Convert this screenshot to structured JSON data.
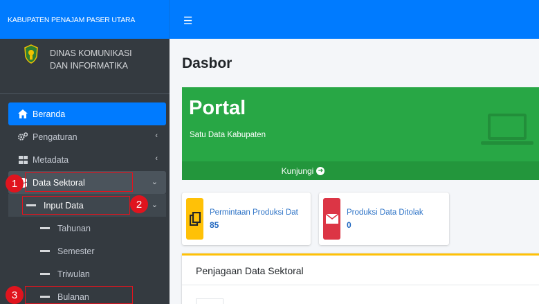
{
  "brand": {
    "title": "KABUPATEN PENAJAM PASER UTARA"
  },
  "user_panel": {
    "org_line1": "DINAS KOMUNIKASI",
    "org_line2": "DAN INFORMATIKA"
  },
  "sidebar": {
    "items": [
      {
        "label": "Beranda",
        "icon": "home-icon"
      },
      {
        "label": "Pengaturan",
        "icon": "cogs-icon"
      },
      {
        "label": "Metadata",
        "icon": "table-icon"
      },
      {
        "label": "Data Sektoral",
        "icon": "database-icon"
      },
      {
        "label": "Input Data",
        "icon": "dash-icon"
      },
      {
        "label": "Tahunan",
        "icon": "dash-icon"
      },
      {
        "label": "Semester",
        "icon": "dash-icon"
      },
      {
        "label": "Triwulan",
        "icon": "dash-icon"
      },
      {
        "label": "Bulanan",
        "icon": "dash-icon"
      }
    ]
  },
  "annotations": {
    "m1": "1",
    "m2": "2",
    "m3": "3"
  },
  "header": {
    "menu_icon": "hamburger-icon"
  },
  "main": {
    "page_title": "Dasbor",
    "hero": {
      "title": "Portal",
      "subtitle": "Satu Data Kabupaten",
      "footer_label": "Kunjungi"
    },
    "info_boxes": [
      {
        "label": "Permintaan Produksi Dat",
        "value": "85",
        "color": "#ffc107",
        "icon": "copy-icon"
      },
      {
        "label": "Produksi Data Ditolak",
        "value": "0",
        "color": "#dc3545",
        "icon": "envelope-icon"
      }
    ],
    "card": {
      "title": "Penjagaan Data Sektoral"
    }
  },
  "colors": {
    "primary": "#007bff",
    "sidebar": "#343a40",
    "success": "#28a745",
    "warning": "#ffc107",
    "danger": "#dc3545",
    "annotation": "#e0141e"
  }
}
